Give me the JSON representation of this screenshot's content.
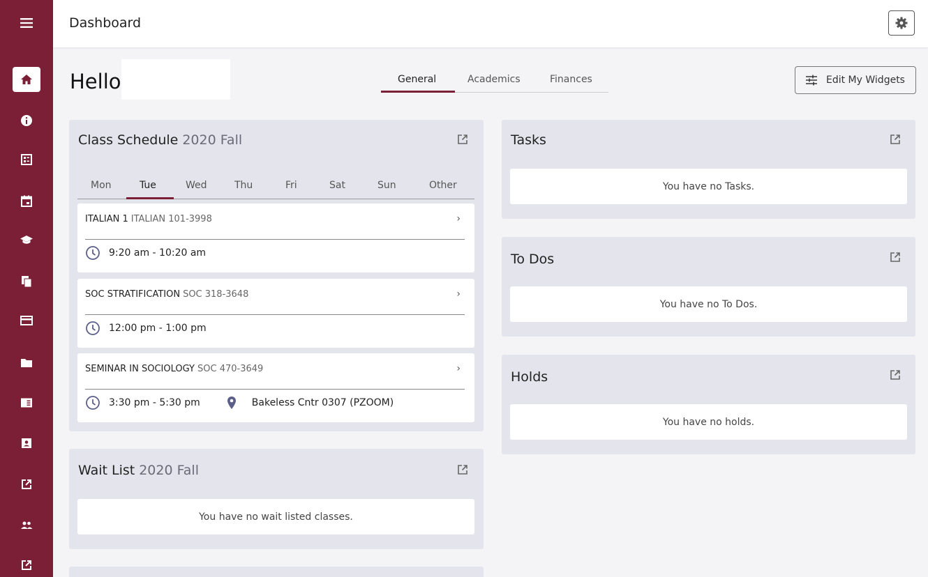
{
  "header": {
    "title": "Dashboard"
  },
  "greeting": "Hello",
  "tabs": [
    "General",
    "Academics",
    "Finances"
  ],
  "edit_widgets_label": "Edit My Widgets",
  "class_schedule": {
    "title": "Class Schedule",
    "term": "2020 Fall",
    "days": [
      "Mon",
      "Tue",
      "Wed",
      "Thu",
      "Fri",
      "Sat",
      "Sun",
      "Other"
    ],
    "classes": [
      {
        "name": "ITALIAN 1",
        "code": "ITALIAN 101-3998",
        "time": "9:20 am - 10:20 am",
        "location": ""
      },
      {
        "name": "SOC STRATIFICATION",
        "code": "SOC 318-3648",
        "time": "12:00 pm - 1:00 pm",
        "location": ""
      },
      {
        "name": "SEMINAR IN SOCIOLOGY",
        "code": "SOC 470-3649",
        "time": "3:30 pm - 5:30 pm",
        "location": "Bakeless Cntr 0307 (PZOOM)"
      }
    ]
  },
  "wait_list": {
    "title": "Wait List",
    "term": "2020 Fall",
    "empty": "You have no wait listed classes."
  },
  "tasks": {
    "title": "Tasks",
    "empty": "You have no Tasks."
  },
  "todos": {
    "title": "To Dos",
    "empty": "You have no To Dos."
  },
  "holds": {
    "title": "Holds",
    "empty": "You have no holds."
  },
  "colors": {
    "brand": "#7b1f36",
    "card_bg": "#e4e4ec",
    "page_bg": "#f4f4f7"
  },
  "sidebar_icons": [
    "menu-icon",
    "home-icon",
    "info-icon",
    "grid-icon",
    "calendar-icon",
    "graduation-cap-icon",
    "documents-icon",
    "credit-card-icon",
    "folder-icon",
    "catalog-icon",
    "contact-card-icon",
    "external-link-icon",
    "people-icon",
    "external-link-icon"
  ]
}
